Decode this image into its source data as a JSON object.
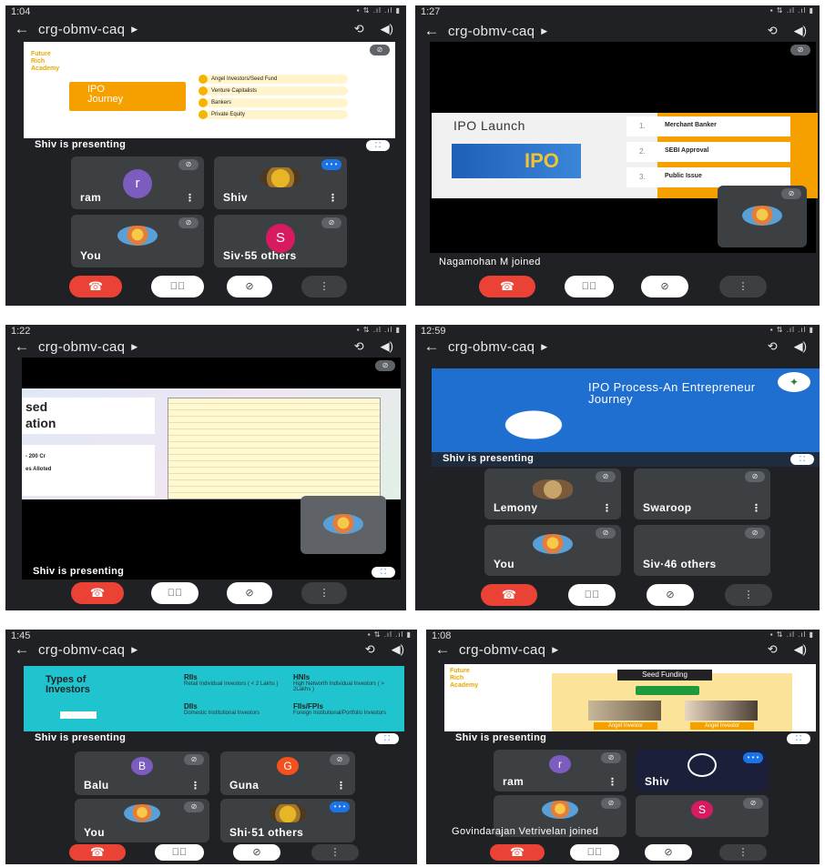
{
  "meeting_code": "crg-obmv-caq",
  "presenting_text": "Shiv is presenting",
  "end_call_icon": "phone-hangup-icon",
  "panels": [
    {
      "time": "1:04",
      "slide": {
        "brand": "Future\nRich\nAcademy",
        "bubble": "IPO\nJourney",
        "items": [
          "Angel Investors/Seed Fund",
          "Venture Capitalists",
          "Bankers",
          "Private Equity"
        ]
      },
      "tiles": [
        "ram",
        "Shiv",
        "You",
        "Siv·55 others"
      ],
      "tile_initials": [
        "r",
        "",
        "",
        "S"
      ],
      "tile_colors": [
        "#7c5cbf",
        "",
        "",
        "#d81b60"
      ]
    },
    {
      "time": "1:27",
      "slide": {
        "title": "IPO Launch",
        "image_text": "IPO",
        "items": [
          "Merchant Banker",
          "SEBI Approval",
          "Public Issue"
        ],
        "numbers": [
          "1.",
          "2.",
          "3."
        ]
      },
      "toast": "Nagamohan M joined"
    },
    {
      "time": "1:22",
      "slide": {
        "left_text": [
          "sed",
          "ation"
        ],
        "small_text": [
          "- 200 Cr",
          "es Alloted"
        ]
      }
    },
    {
      "time": "12:59",
      "slide": {
        "title": "IPO Process-An Entrepreneur Journey"
      },
      "tiles": [
        "Lemony",
        "Swaroop",
        "You",
        "Siv·46 others"
      ]
    },
    {
      "time": "1:45",
      "slide": {
        "title": "Types of Investors",
        "blocks": [
          {
            "h": "RIIs",
            "t": "Retail Individual Investors ( < 2 Lakhs )"
          },
          {
            "h": "HNIs",
            "t": "High Networth Individual Investors ( > 2Lakhs )"
          },
          {
            "h": "DIIs",
            "t": "Domestic Institutional Investors"
          },
          {
            "h": "FIIs/FPIs",
            "t": "Foreign Institutional/Portfolio Investors"
          }
        ]
      },
      "tiles": [
        "Balu",
        "Guna",
        "You",
        "Shi·51 others"
      ],
      "tile_initials": [
        "B",
        "G",
        "",
        ""
      ],
      "tile_colors": [
        "#7c5cbf",
        "#f4511e",
        "",
        ""
      ]
    },
    {
      "time": "1:08",
      "slide": {
        "brand": "Future\nRich\nAcademy",
        "title": "Seed Funding",
        "captions": [
          "Angel Investor",
          "Angel Investor"
        ]
      },
      "tiles": [
        "ram",
        "Shiv",
        "",
        ""
      ],
      "tile_initials": [
        "r",
        "",
        "",
        "S"
      ],
      "tile_colors": [
        "#7c5cbf",
        "",
        "",
        "#d81b60"
      ],
      "toast": "Govindarajan Vetrivelan joined"
    }
  ]
}
